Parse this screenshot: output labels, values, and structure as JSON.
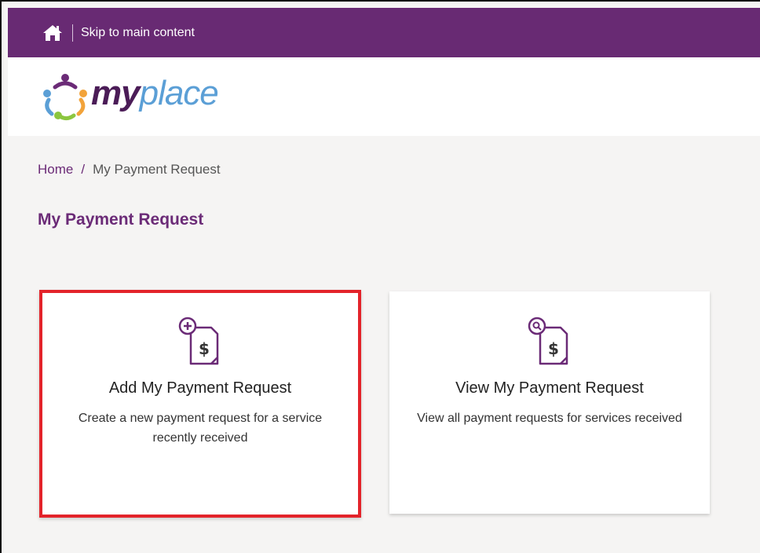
{
  "header": {
    "skip_link": "Skip to main content",
    "home_icon": "home-icon"
  },
  "logo": {
    "text_my": "my",
    "text_place": "place"
  },
  "breadcrumb": {
    "home": "Home",
    "separator": "/",
    "current": "My Payment Request"
  },
  "page": {
    "title": "My Payment Request"
  },
  "cards": [
    {
      "title": "Add My Payment Request",
      "description": "Create a new payment request for a service recently received",
      "icon": "add-payment-document-icon"
    },
    {
      "title": "View My Payment Request",
      "description": "View all payment requests for services received",
      "icon": "view-payment-document-icon"
    }
  ],
  "colors": {
    "brand_purple": "#682a73",
    "highlight_red": "#e3232a",
    "logo_blue": "#5b9fd6"
  }
}
